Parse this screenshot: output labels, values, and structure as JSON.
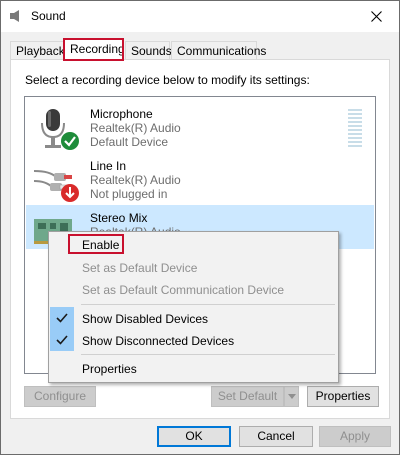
{
  "window": {
    "title": "Sound"
  },
  "tabs": [
    "Playback",
    "Recording",
    "Sounds",
    "Communications"
  ],
  "instruction": "Select a recording device below to modify its settings:",
  "devices": [
    {
      "name": "Microphone",
      "line1": "Realtek(R) Audio",
      "line2": "Default Device",
      "status_icon": "green-check-icon"
    },
    {
      "name": "Line In",
      "line1": "Realtek(R) Audio",
      "line2": "Not plugged in",
      "status_icon": "red-down-arrow-icon"
    },
    {
      "name": "Stereo Mix",
      "line1": "Realtek(R) Audio",
      "status_icon": "none"
    }
  ],
  "context_menu": {
    "enable": "Enable",
    "set_default": "Set as Default Device",
    "set_default_comm": "Set as Default Communication Device",
    "show_disabled": "Show Disabled Devices",
    "show_disconnected": "Show Disconnected Devices",
    "properties": "Properties"
  },
  "panel_buttons": {
    "configure": "Configure",
    "set_default": "Set Default",
    "properties": "Properties"
  },
  "dialog_buttons": {
    "ok": "OK",
    "cancel": "Cancel",
    "apply": "Apply"
  },
  "colors": {
    "selection": "#cce8ff",
    "highlight_box": "#c8102e",
    "check_bg": "#99ccf7",
    "default_button_border": "#0078d7"
  }
}
